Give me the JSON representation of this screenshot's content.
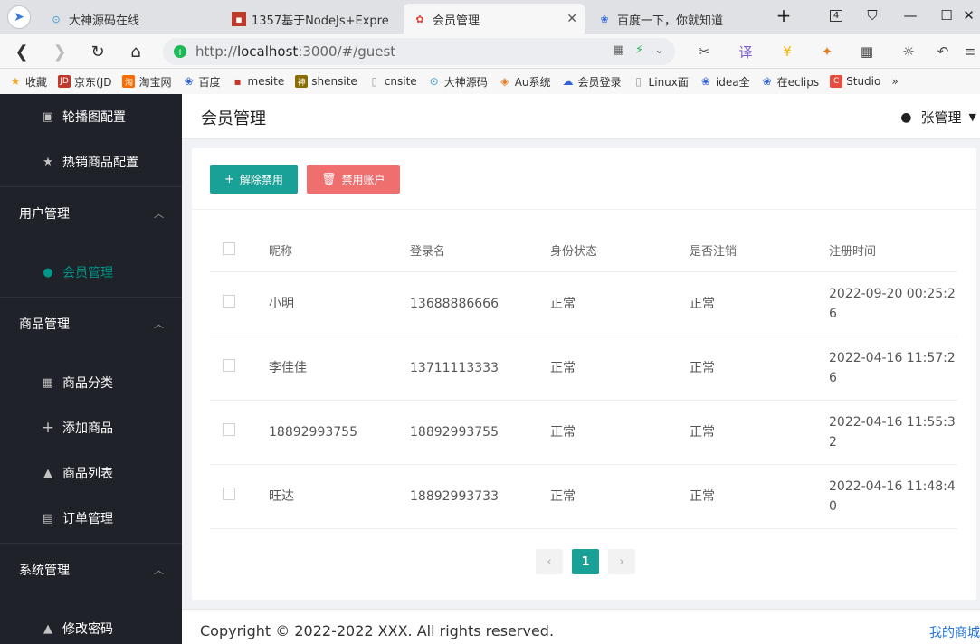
{
  "browser": {
    "tabs": [
      {
        "title": "大神源码在线",
        "favicon": "swirl-icon"
      },
      {
        "title": "1357基于NodeJs+Expre",
        "favicon": "red-block-icon"
      },
      {
        "title": "会员管理",
        "favicon": "huawei-icon",
        "active": true
      },
      {
        "title": "百度一下，你就知道",
        "favicon": "paw-icon"
      }
    ],
    "new_tab": "+",
    "tab_count": "4",
    "url_prefix": "http://",
    "url_host": "localhost",
    "url_rest": ":3000/#/guest",
    "bookmarks": [
      {
        "label": "收藏",
        "color": "#f5a623",
        "icon": "star-icon"
      },
      {
        "label": "京东(JD",
        "color": "#c0392b",
        "icon": "jd-icon",
        "text": "JD"
      },
      {
        "label": "淘宝网",
        "color": "#ff6a00",
        "icon": "taobao-icon",
        "text": "淘"
      },
      {
        "label": "百度",
        "color": "#2f62d8",
        "icon": "paw-icon"
      },
      {
        "label": "mesite",
        "color": "#c0392b",
        "icon": "red-block-icon"
      },
      {
        "label": "shensite",
        "color": "#8a6d00",
        "icon": "shen-icon",
        "text": "神"
      },
      {
        "label": "cnsite",
        "color": "#999",
        "icon": "page-icon"
      },
      {
        "label": "大神源码",
        "color": "#3a9bd5",
        "icon": "swirl-icon"
      },
      {
        "label": "Au系统",
        "color": "#e67e22",
        "icon": "au-icon"
      },
      {
        "label": "会员登录",
        "color": "#2f62d8",
        "icon": "cloud-icon"
      },
      {
        "label": "Linux面",
        "color": "#999",
        "icon": "page-icon"
      },
      {
        "label": "idea全",
        "color": "#2f62d8",
        "icon": "paw-icon"
      },
      {
        "label": "在eclips",
        "color": "#2f62d8",
        "icon": "paw-icon"
      },
      {
        "label": "Studio",
        "color": "#e74c3c",
        "icon": "studio-icon",
        "text": "C"
      }
    ],
    "bookmarks_more": "»"
  },
  "sidebar": {
    "items_top": [
      {
        "label": "轮播图配置",
        "icon": "image-icon"
      },
      {
        "label": "热销商品配置",
        "icon": "star-icon"
      }
    ],
    "group_user": "用户管理",
    "item_member": "会员管理",
    "group_goods": "商品管理",
    "items_goods": [
      {
        "label": "商品分类",
        "icon": "grid-icon"
      },
      {
        "label": "添加商品",
        "icon": "plus-icon"
      },
      {
        "label": "商品列表",
        "icon": "lock-icon"
      },
      {
        "label": "订单管理",
        "icon": "list-icon"
      }
    ],
    "group_system": "系统管理",
    "item_password": "修改密码"
  },
  "header": {
    "title": "会员管理",
    "user": "张管理"
  },
  "toolbar": {
    "unban_label": "解除禁用",
    "ban_label": "禁用账户"
  },
  "table": {
    "columns": [
      "昵称",
      "登录名",
      "身份状态",
      "是否注销",
      "注册时间"
    ],
    "rows": [
      {
        "nickname": "小明",
        "login": "13688886666",
        "status": "正常",
        "cancelled": "正常",
        "reg_time_1": "2022-09-20 00:25:2",
        "reg_time_2": "6"
      },
      {
        "nickname": "李佳佳",
        "login": "13711113333",
        "status": "正常",
        "cancelled": "正常",
        "reg_time_1": "2022-04-16 11:57:2",
        "reg_time_2": "6"
      },
      {
        "nickname": "18892993755",
        "login": "18892993755",
        "status": "正常",
        "cancelled": "正常",
        "reg_time_1": "2022-04-16 11:55:3",
        "reg_time_2": "2"
      },
      {
        "nickname": "旺达",
        "login": "18892993733",
        "status": "正常",
        "cancelled": "正常",
        "reg_time_1": "2022-04-16 11:48:4",
        "reg_time_2": "0"
      }
    ]
  },
  "pagination": {
    "prev": "‹",
    "current": "1",
    "next": "›"
  },
  "footer": {
    "copyright": "Copyright © 2022-2022 XXX. All rights reserved.",
    "link": "我的商城"
  },
  "colors": {
    "accent": "#1aa197",
    "danger": "#ef6f6f",
    "sidebar": "#20222a",
    "ok_text": "#2e8b2e"
  }
}
